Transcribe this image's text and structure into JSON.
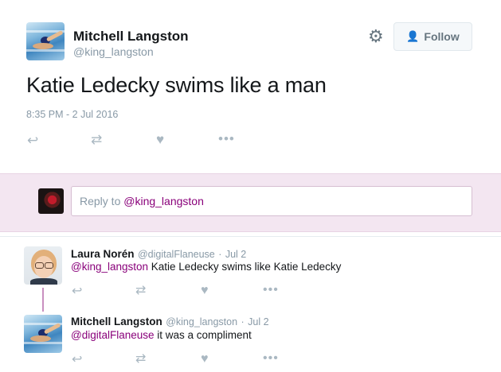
{
  "tweet": {
    "author_name": "Mitchell Langston",
    "author_handle": "@king_langston",
    "text": "Katie Ledecky swims like a man",
    "timestamp": "8:35 PM - 2 Jul 2016",
    "follow_label": "Follow",
    "icons": {
      "settings": "gear-icon",
      "follow": "add-user-icon",
      "reply": "reply-icon",
      "retweet": "retweet-icon",
      "like": "heart-icon",
      "more": "more-icon"
    }
  },
  "reply_composer": {
    "prefix": "Reply to",
    "mention": "@king_langston"
  },
  "replies": [
    {
      "name": "Laura Norén",
      "handle": "@digitalFlaneuse",
      "date": "Jul 2",
      "mention": "@king_langston",
      "text": " Katie Ledecky swims like Katie Ledecky"
    },
    {
      "name": "Mitchell Langston",
      "handle": "@king_langston",
      "date": "Jul 2",
      "mention": "@digitalFlaneuse",
      "text": " it was a compliment"
    }
  ],
  "colors": {
    "mention": "#89007a",
    "reply_band": "#f3e6f1",
    "thread_line": "#c98fc0",
    "muted": "#8899a6",
    "follow_plus": "#1da1f2"
  }
}
